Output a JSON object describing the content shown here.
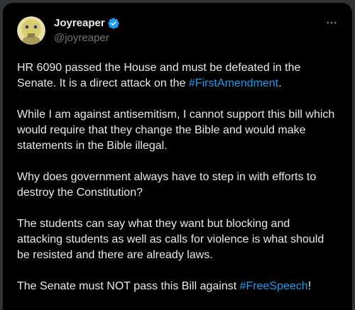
{
  "author": {
    "display_name": "Joyreaper",
    "handle": "@joyreaper"
  },
  "icons": {
    "verified": "verified-badge-icon",
    "more": "more-options-icon",
    "avatar": "user-avatar"
  },
  "colors": {
    "background": "#000000",
    "text": "#e7e9ea",
    "secondary_text": "#71767b",
    "link": "#1d9bf0",
    "verified_badge": "#1d9bf0"
  },
  "post": {
    "p1_before": "HR 6090 passed the House and must be defeated in the Senate. It is a direct attack on the ",
    "p1_hashtag": "#FirstAmendment",
    "p1_after": ".",
    "p2": "While I am against antisemitism, I cannot support this bill which would require that they change the Bible and would make statements in the Bible illegal.",
    "p3": "Why does government always have to step in with efforts to destroy the Constitution?",
    "p4": "The students can say what they want but blocking and attacking students as well as calls for violence is what should be resisted and there are already laws.",
    "p5_before": "The Senate must NOT pass this Bill against ",
    "p5_hashtag": "#FreeSpeech",
    "p5_after": "!"
  }
}
